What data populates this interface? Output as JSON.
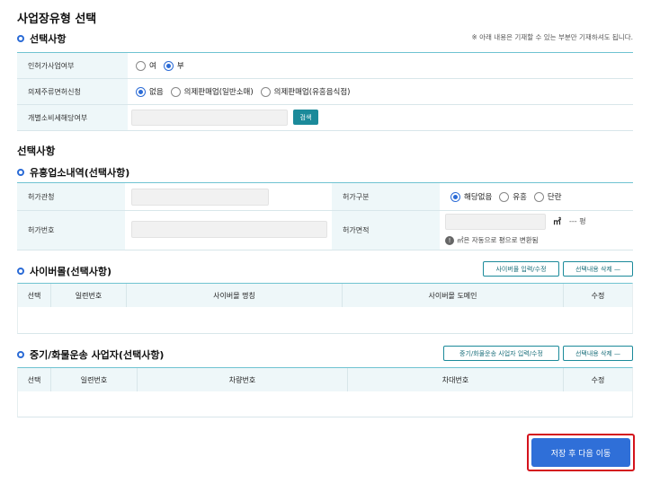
{
  "page_title": "사업장유형 선택",
  "section1": {
    "heading": "선택사항",
    "note": "※ 아래 내용은 기재할 수 있는 부분만 기재하셔도 됩니다.",
    "rows": {
      "permit": {
        "label": "인허가사업여부",
        "options": [
          "여",
          "부"
        ],
        "selected": "부"
      },
      "liquor": {
        "label": "의제주류면허신청",
        "options": [
          "없음",
          "의제판매업(일반소매)",
          "의제판매업(유흥음식점)"
        ],
        "selected": "없음"
      },
      "tax": {
        "label": "개별소비세해당여부",
        "search_label": "검색"
      }
    }
  },
  "section2_title": "선택사항",
  "entertainment": {
    "heading": "유흥업소내역(선택사항)",
    "authority_label": "허가관청",
    "type_label": "허가구분",
    "type_options": [
      "해당없음",
      "유흥",
      "단란"
    ],
    "type_selected": "해당없음",
    "number_label": "허가번호",
    "area_label": "허가면적",
    "area_unit": "㎡",
    "area_pyeong": "--- 평",
    "area_hint": "㎡은 자동으로 평으로 변환됨"
  },
  "cyber": {
    "heading": "사이버몰(선택사항)",
    "input_button": "사이버몰 입력/수정",
    "delete_button": "선택내용 삭제 —",
    "columns": [
      "선택",
      "일련번호",
      "사이버몰 명칭",
      "사이버몰 도메인",
      "수정"
    ]
  },
  "freight": {
    "heading": "중기/화물운송 사업자(선택사항)",
    "input_button": "중기/화물운송 사업자 입력/수정",
    "delete_button": "선택내용 삭제 —",
    "columns": [
      "선택",
      "일련번호",
      "차량번호",
      "차대번호",
      "수정"
    ]
  },
  "submit_label": "저장 후 다음 이동",
  "colors": {
    "accent": "#2b6bd6",
    "teal": "#1b8a9a",
    "header_bg": "#eef7f9",
    "highlight": "#d4131c",
    "submit": "#2f6fd8"
  }
}
